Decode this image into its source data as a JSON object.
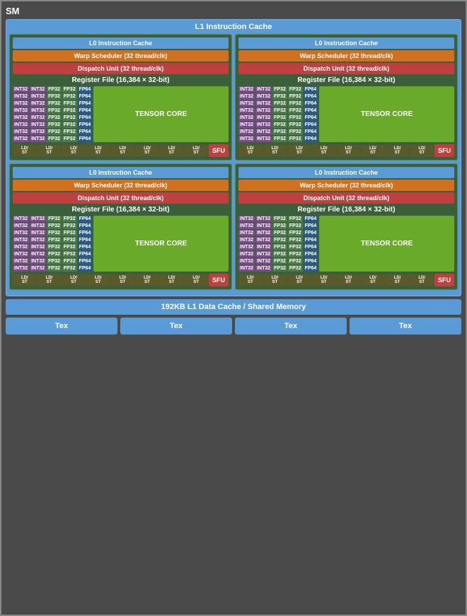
{
  "sm": {
    "title": "SM",
    "l1_instruction_cache": "L1 Instruction Cache",
    "l1_data_cache": "192KB L1 Data Cache / Shared Memory",
    "quadrant": {
      "l0_cache": "L0 Instruction Cache",
      "warp_scheduler": "Warp Scheduler (32 thread/clk)",
      "dispatch_unit": "Dispatch Unit (32 thread/clk)",
      "register_file": "Register File (16,384 × 32-bit)",
      "tensor_core": "TENSOR CORE",
      "sfu": "SFU"
    },
    "tex_labels": [
      "Tex",
      "Tex",
      "Tex",
      "Tex"
    ],
    "core_rows": 8,
    "int32_cols": 2,
    "fp32_cols": 2,
    "fp64_cols": 1,
    "ld_st_count": 8
  }
}
